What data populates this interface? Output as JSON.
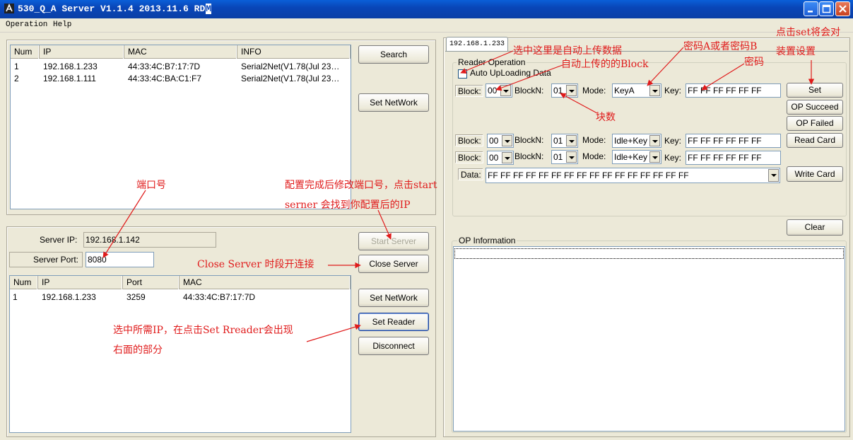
{
  "window": {
    "title": "530_Q_A Server V1.1.4 2013.11.6 RD",
    "title_mark": "M",
    "colors": {
      "titlebar": "#0a46b8",
      "annotation": "#e01b1b",
      "face": "#ece9d8"
    }
  },
  "menu": [
    "Operation",
    "Help"
  ],
  "device_list": {
    "columns": [
      "Num",
      "IP",
      "MAC",
      "INFO"
    ],
    "rows": [
      {
        "num": "1",
        "ip": "192.168.1.233",
        "mac": "44:33:4C:B7:17:7D",
        "info": "Serial2Net(V1.78(Jul 23…"
      },
      {
        "num": "2",
        "ip": "192.168.1.111",
        "mac": "44:33:4C:BA:C1:F7",
        "info": "Serial2Net(V1.78(Jul 23…"
      }
    ],
    "search_label": "Search",
    "set_network_label": "Set NetWork"
  },
  "server": {
    "ip_label": "Server IP:",
    "ip_value": "192.168.1.142",
    "port_label": "Server Port:",
    "port_value": "8080",
    "start_label": "Start Server",
    "close_label": "Close Server",
    "set_network_label": "Set NetWork",
    "set_reader_label": "Set Reader",
    "disconnect_label": "Disconnect"
  },
  "client_list": {
    "columns": [
      "Num",
      "IP",
      "Port",
      "MAC"
    ],
    "rows": [
      {
        "num": "1",
        "ip": "192.168.1.233",
        "port": "3259",
        "mac": "44:33:4C:B7:17:7D"
      }
    ]
  },
  "reader": {
    "tab_label": "192.168.1.233",
    "group_title": "Reader Operation",
    "auto_upload_label": "Auto UpLoading Data",
    "auto_upload_checked": false,
    "block_label": "Block:",
    "blockn_label": "BlockN:",
    "mode_label": "Mode:",
    "key_label": "Key:",
    "data_label": "Data:",
    "row1": {
      "block": "00",
      "blockn": "01",
      "mode": "KeyA",
      "key": "FF FF FF FF FF FF"
    },
    "row2": {
      "block": "00",
      "blockn": "01",
      "mode": "Idle+Key",
      "key": "FF FF FF FF FF FF"
    },
    "row3": {
      "block": "00",
      "blockn": "01",
      "mode": "Idle+Key",
      "key": "FF FF FF FF FF FF"
    },
    "data_value": "FF FF FF FF FF FF FF FF FF FF FF FF FF FF FF FF",
    "set_label": "Set",
    "op_succeed_label": "OP Succeed",
    "op_failed_label": "OP Failed",
    "read_card_label": "Read Card",
    "write_card_label": "Write Card",
    "clear_label": "Clear",
    "op_info_title": "OP Information"
  },
  "annotations": {
    "auto_upload": "选中这里是自动上传数据",
    "auto_block": "自动上传的的Block",
    "key_ab": "密码A或者密码B",
    "password": "密码",
    "set_note_1": "点击set将会对",
    "set_note_2": "装置设置",
    "blocks_count": "块数",
    "port": "端口号",
    "restart_1": "配置完成后修改端口号，点击start",
    "restart_2": "serner 会找到你配置后的IP",
    "close_server": "Close Server 时段开连接",
    "set_reader_1": "选中所需IP，在点击Set Rreader会出现",
    "set_reader_2": "右面的部分"
  }
}
